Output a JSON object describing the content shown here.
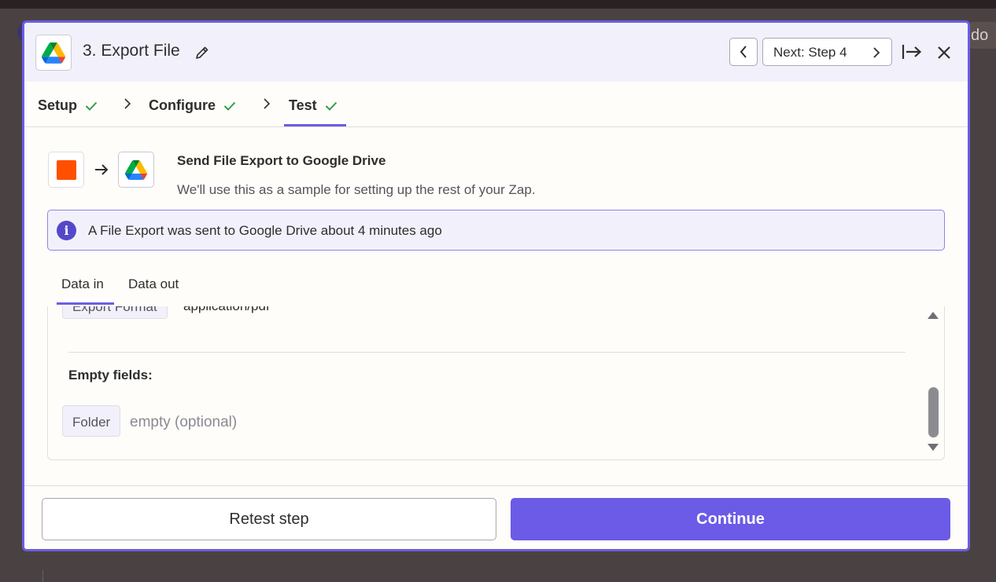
{
  "background": {
    "right_glyph": "do"
  },
  "modal": {
    "title": "3. Export File",
    "app_icon": "google-drive-icon",
    "nav": {
      "prev_icon": "chevron-left-icon",
      "next_label": "Next: Step 4",
      "next_icon": "chevron-right-icon",
      "collapse_icon": "arrow-to-right-icon",
      "close_icon": "close-icon"
    },
    "steps": [
      {
        "label": "Setup",
        "complete": true
      },
      {
        "label": "Configure",
        "complete": true
      },
      {
        "label": "Test",
        "complete": true,
        "active": true
      }
    ],
    "sample": {
      "title": "Send File Export to Google Drive",
      "description": "We'll use this as a sample for setting up the rest of your Zap."
    },
    "banner": {
      "text": "A File Export was sent to Google Drive about 4 minutes ago"
    },
    "tabs": [
      {
        "label": "Data in",
        "active": true
      },
      {
        "label": "Data out",
        "active": false
      }
    ],
    "data_in": {
      "cut_field": {
        "label": "Export Format",
        "value": "application/pdf"
      },
      "empty_heading": "Empty fields:",
      "empty_fields": [
        {
          "label": "Folder",
          "value": "empty (optional)"
        }
      ]
    },
    "footer": {
      "retest_label": "Retest step",
      "continue_label": "Continue"
    }
  },
  "colors": {
    "accent": "#6b5be6",
    "success_check": "#2e9e4f",
    "zapier_orange": "#ff4f00"
  }
}
